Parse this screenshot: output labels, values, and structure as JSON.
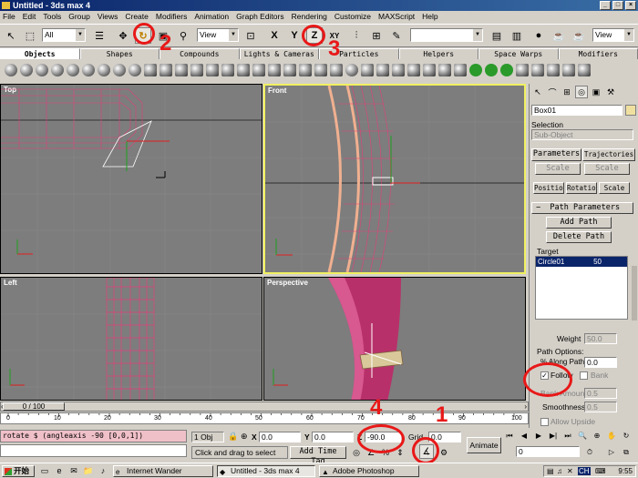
{
  "window": {
    "title": "Untitled - 3ds max 4"
  },
  "menu": [
    "File",
    "Edit",
    "Tools",
    "Group",
    "Views",
    "Create",
    "Modifiers",
    "Animation",
    "Graph Editors",
    "Rendering",
    "Customize",
    "MAXScript",
    "Help"
  ],
  "toolbar": {
    "selection_filter": "All",
    "ref_coord": "View",
    "right_view": "View"
  },
  "tabs": [
    "Objects",
    "Shapes",
    "Compounds",
    "Lights & Cameras",
    "Particles",
    "Helpers",
    "Space Warps",
    "Modifiers"
  ],
  "viewports": {
    "top": "Top",
    "front": "Front",
    "left": "Left",
    "perspective": "Perspective"
  },
  "command_panel": {
    "object_name": "Box01",
    "selection_label": "Selection",
    "sub_object": "Sub-Object",
    "tab_parameters": "Parameters",
    "tab_trajectories": "Trajectories",
    "scale_btn1": "Scale",
    "scale_btn2": "Scale",
    "position_btn": "Position",
    "rotation_btn": "Rotation",
    "scale_btn3": "Scale",
    "rollout_title": "Path Parameters",
    "add_path": "Add Path",
    "delete_path": "Delete Path",
    "target_label": "Target",
    "target_name": "Circle01",
    "target_weight": "50",
    "weight_label": "Weight",
    "weight_value": "50.0",
    "path_options_label": "Path Options:",
    "along_path_label": "% Along Path:",
    "along_path_value": "0.0",
    "follow_label": "Follow",
    "bank_label": "Bank",
    "bank_amount_label": "Bank Amount:",
    "bank_amount_value": "0.5",
    "smoothness_label": "Smoothness:",
    "smoothness_value": "0.5",
    "allow_upside": "Allow Upside"
  },
  "timeline": {
    "frame_display": "0 / 100",
    "ticks": [
      "0",
      "10",
      "20",
      "30",
      "40",
      "50",
      "60",
      "70",
      "80",
      "90",
      "100"
    ]
  },
  "status": {
    "maxscript_line": "rotate $ (angleaxis -90 [0,0,1])",
    "selected": "1 Obj",
    "x_label": "X",
    "x_value": "0.0",
    "y_label": "Y",
    "y_value": "0.0",
    "z_value": "-90.0",
    "grid_label": "Grid",
    "grid_value": "0.0",
    "prompt": "Click and drag to select",
    "add_time_tag": "Add Time Tag",
    "animate_btn": "Animate",
    "frame_value": "0"
  },
  "annotations": {
    "n1": "1",
    "n2": "2",
    "n3": "3",
    "n4": "4"
  },
  "taskbar": {
    "start": "开始",
    "tasks": [
      "Internet Wander",
      "Untitled - 3ds max 4",
      "Adobe Photoshop"
    ],
    "lang": "CH",
    "clock": "9:55"
  },
  "colors": {
    "viewport_bg": "#7d7d7d",
    "wire_pink": "#e0407a",
    "annotation_red": "#e81818",
    "active_border": "#f0f060"
  }
}
